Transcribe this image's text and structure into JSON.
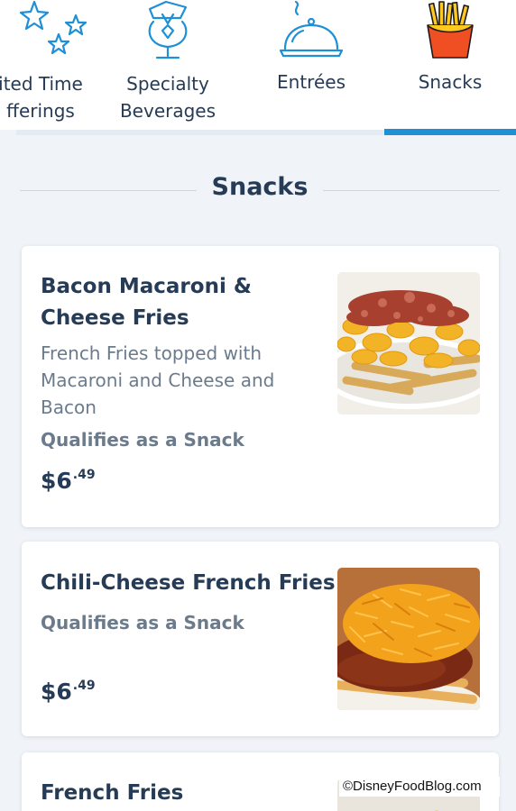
{
  "category_tabs": [
    {
      "label_line1": "ited Time",
      "label_line2": "fferings",
      "icon": "stars-icon"
    },
    {
      "label_line1": "Specialty",
      "label_line2": "Beverages",
      "icon": "cocktail-icon"
    },
    {
      "label_line1": "Entrées",
      "icon": "cloche-icon"
    },
    {
      "label_line1": "Snacks",
      "icon": "fries-icon",
      "selected": true
    }
  ],
  "colors": {
    "accent": "#1f8fd6",
    "text_dark": "#253b56",
    "text_muted": "#6c7b8c",
    "background": "#f0f4f8",
    "fries_red": "#f04e23",
    "fries_yellow": "#ffc91f"
  },
  "section": {
    "title": "Snacks"
  },
  "menu_items": [
    {
      "name": "Bacon Macaroni & Cheese Fries",
      "description": "French Fries topped with Macaroni and Cheese and Bacon",
      "qualifies": "Qualifies as a Snack",
      "price_dollars": "$6",
      "price_cents": ".49",
      "image": "bacon-mac-fries-photo"
    },
    {
      "name": "Chili-Cheese French Fries",
      "qualifies": "Qualifies as a Snack",
      "price_dollars": "$6",
      "price_cents": ".49",
      "image": "chili-cheese-fries-photo"
    },
    {
      "name": "French Fries",
      "image": "french-fries-photo"
    }
  ],
  "watermark": "©DisneyFoodBlog.com"
}
